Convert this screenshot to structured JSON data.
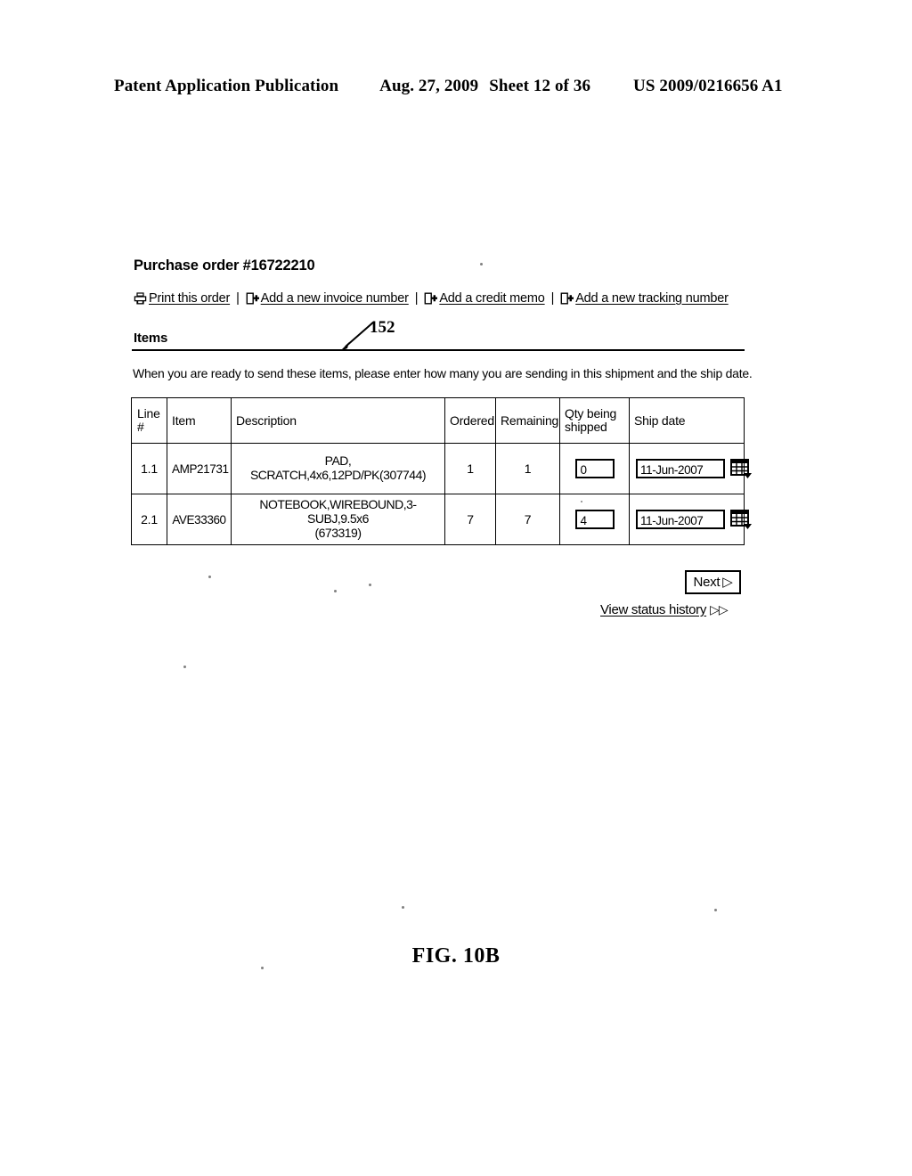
{
  "patent_header": {
    "publication": "Patent Application Publication",
    "date": "Aug. 27, 2009",
    "sheet": "Sheet 12 of 36",
    "patent_number": "US 2009/0216656 A1"
  },
  "figure": {
    "caption": "FIG. 10B",
    "reference_numeral": "152"
  },
  "screen": {
    "title": "Purchase order #16722210",
    "actions": [
      {
        "icon": "printer-icon",
        "label": "Print this order"
      },
      {
        "icon": "add-page-icon",
        "label": "Add a new invoice number"
      },
      {
        "icon": "add-page-icon",
        "label": "Add a credit memo"
      },
      {
        "icon": "add-page-icon",
        "label": "Add a new tracking number"
      }
    ],
    "separator": "|",
    "section_heading": "Items",
    "instruction": "When you are ready to send these items, please enter how many you are sending in this shipment and the ship date.",
    "table": {
      "headers": {
        "line": "Line #",
        "line_l1": "Line",
        "line_l2": "#",
        "item": "Item",
        "description": "Description",
        "ordered": "Ordered",
        "remaining": "Remaining",
        "qty_l1": "Qty being",
        "qty_l2": "shipped",
        "ship_date": "Ship date"
      },
      "rows": [
        {
          "line": "1.1",
          "item": "AMP21731",
          "description_l1": "PAD, SCRATCH,4x6,12PD/PK(307744)",
          "description_l2": "",
          "ordered": "1",
          "remaining": "1",
          "qty_shipped": "0",
          "ship_date": "11-Jun-2007"
        },
        {
          "line": "2.1",
          "item": "AVE33360",
          "description_l1": "NOTEBOOK,WIREBOUND,3-SUBJ,9.5x6",
          "description_l2": "(673319)",
          "ordered": "7",
          "remaining": "7",
          "qty_shipped": "4",
          "ship_date": "11-Jun-2007"
        }
      ]
    },
    "next_button": "Next",
    "next_button_arrow": "▷",
    "status_history_link": "View status history",
    "status_history_arrows": "▷▷"
  }
}
